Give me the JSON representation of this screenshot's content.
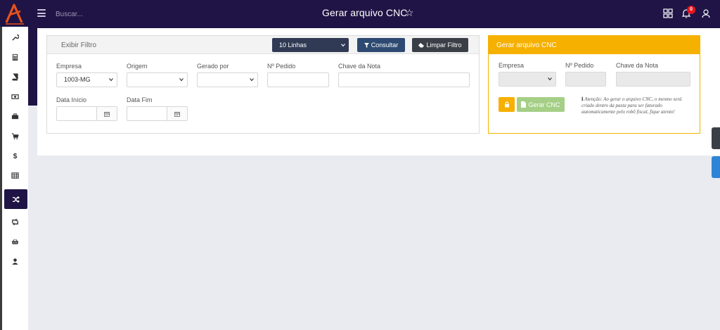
{
  "header": {
    "title": "Gerar arquivo CNC",
    "search_placeholder": "Buscar...",
    "notification_count": "0",
    "icons": [
      "menu-icon",
      "star-icon",
      "grid-icon",
      "bell-icon",
      "user-icon"
    ]
  },
  "sidebar": {
    "items": [
      {
        "name": "wrench-icon",
        "active": false
      },
      {
        "name": "calculator-icon",
        "active": false
      },
      {
        "name": "book-icon",
        "active": false
      },
      {
        "name": "money-icon",
        "active": false
      },
      {
        "name": "briefcase-icon",
        "active": false
      },
      {
        "name": "cart-icon",
        "active": false
      },
      {
        "name": "dollar-icon",
        "active": false
      },
      {
        "name": "table-icon",
        "active": false
      },
      {
        "name": "shuffle-icon",
        "active": true
      },
      {
        "name": "retweet-icon",
        "active": false
      },
      {
        "name": "basket-icon",
        "active": false
      },
      {
        "name": "user-icon",
        "active": false
      }
    ]
  },
  "filter": {
    "title": "Exibir Filtro",
    "lines_select": "10 Linhas",
    "consultar": "Consultar",
    "limpar": "Limpar Filtro",
    "fields": {
      "empresa_label": "Empresa",
      "empresa_value": "1003-MG",
      "origem_label": "Origem",
      "gerado_label": "Gerado por",
      "pedido_label": "Nº Pedido",
      "chave_label": "Chave da Nota",
      "data_inicio_label": "Data Início",
      "data_fim_label": "Data Fim"
    }
  },
  "cnc": {
    "title": "Gerar arquivo CNC",
    "empresa_label": "Empresa",
    "pedido_label": "Nº Pedido",
    "chave_label": "Chave da Nota",
    "gerar_label": "Gerar CNC",
    "note": "Atenção: Ao gerar o arquivo CNC, o mesmo será criado dentro da pasta para ser faturado automaticamente pelo robô fiscal, fique atento!"
  },
  "colors": {
    "brand_dark": "#1f1445",
    "accent_orange": "#f6b000",
    "consultar_blue": "#2e4a72",
    "success_green": "#a5cf87",
    "badge_red": "#e4151f"
  }
}
